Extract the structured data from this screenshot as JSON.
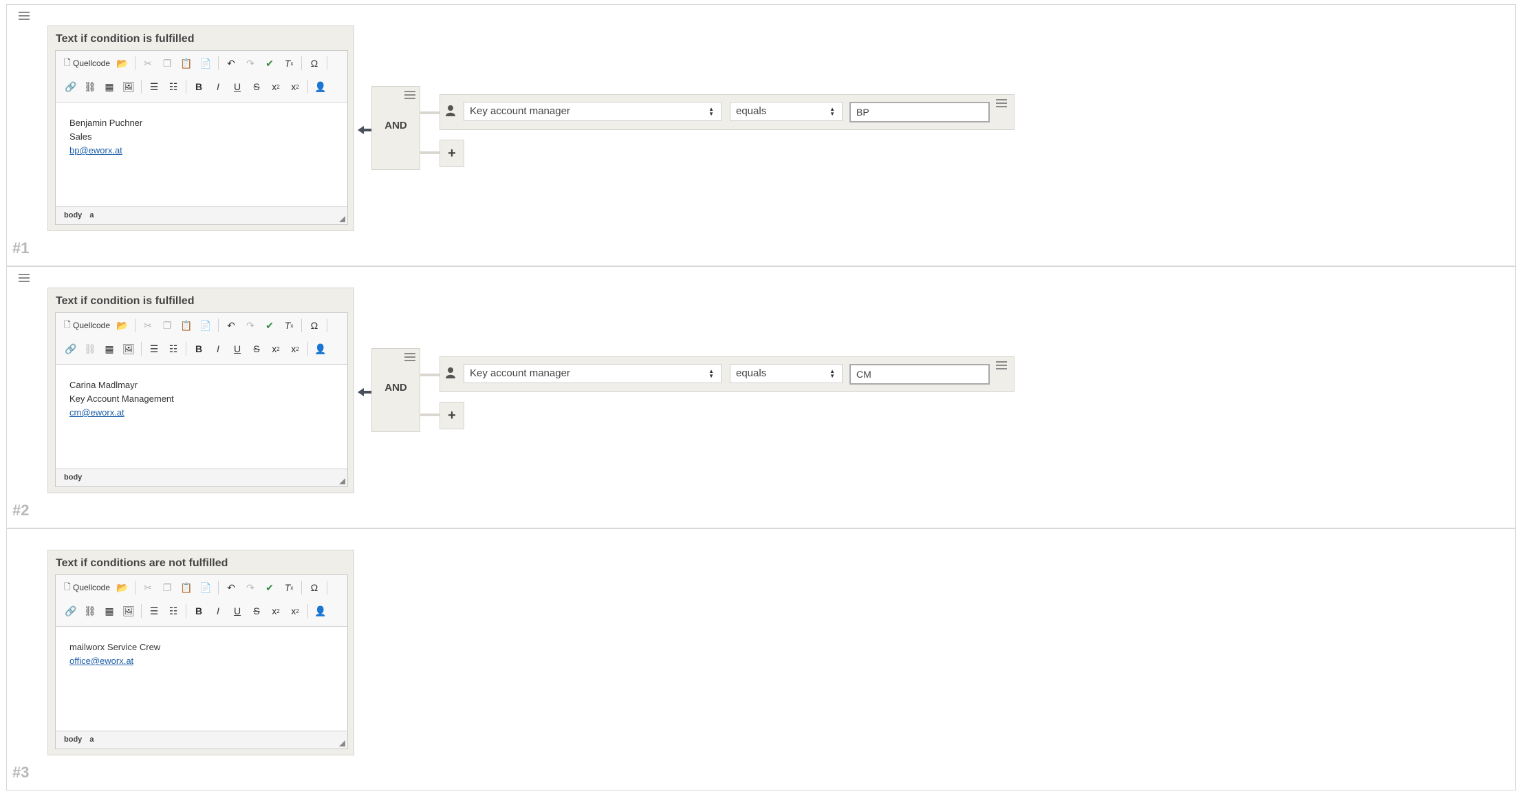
{
  "toolbar": {
    "source_label": "Quellcode",
    "icons": [
      "open-icon",
      "cut-icon",
      "copy-icon",
      "paste-icon",
      "paste-text-icon",
      "undo-icon",
      "redo-icon",
      "spellcheck-icon",
      "remove-format-icon",
      "special-char-icon",
      "link-icon",
      "unlink-icon",
      "table-icon",
      "image-icon",
      "numbered-list-icon",
      "bulleted-list-icon",
      "bold-icon",
      "italic-icon",
      "underline-icon",
      "strikethrough-icon",
      "subscript-icon",
      "superscript-icon",
      "person-icon"
    ]
  },
  "blocks": [
    {
      "number": "#1",
      "title": "Text if condition is fulfilled",
      "lines": [
        "Benjamin Puchner",
        "Sales"
      ],
      "email": "bp@eworx.at",
      "path": [
        "body",
        "a"
      ],
      "operator_group": "AND",
      "condition": {
        "field": "Key account manager",
        "operator": "equals",
        "value": "BP"
      }
    },
    {
      "number": "#2",
      "title": "Text if condition is fulfilled",
      "lines": [
        "Carina Madlmayr",
        "Key Account Management"
      ],
      "email": "cm@eworx.at",
      "path": [
        "body"
      ],
      "operator_group": "AND",
      "condition": {
        "field": "Key account manager",
        "operator": "equals",
        "value": "CM"
      }
    },
    {
      "number": "#3",
      "title": "Text if conditions are not fulfilled",
      "lines": [
        "mailworx Service Crew"
      ],
      "email": "office@eworx.at",
      "path": [
        "body",
        "a"
      ]
    }
  ],
  "colors": {
    "link": "#1e5fa8",
    "panel_bg": "#efeee9",
    "border": "#d5d3cc",
    "number": "#b8b8b8"
  }
}
